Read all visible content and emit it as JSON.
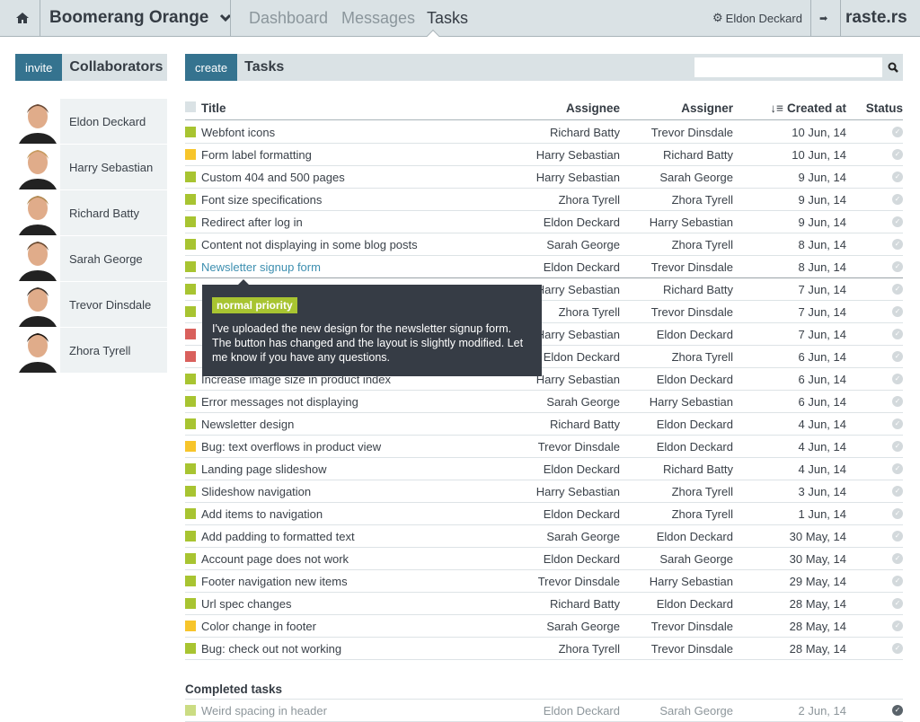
{
  "header": {
    "project": "Boomerang Orange",
    "nav": [
      "Dashboard",
      "Messages",
      "Tasks"
    ],
    "active_nav": "Tasks",
    "user": "Eldon Deckard",
    "brand": "raste.rs"
  },
  "collaborators": {
    "invite_label": "invite",
    "title": "Collaborators",
    "people": [
      "Eldon Deckard",
      "Harry Sebastian",
      "Richard Batty",
      "Sarah George",
      "Trevor Dinsdale",
      "Zhora Tyrell"
    ]
  },
  "tasks": {
    "create_label": "create",
    "title": "Tasks",
    "search_placeholder": "",
    "columns": {
      "title": "Title",
      "assignee": "Assignee",
      "assigner": "Assigner",
      "created": "Created at",
      "status": "Status"
    },
    "colors": {
      "normal": "#a8c431",
      "medium": "#f7c52b",
      "high": "#d9605c"
    },
    "rows": [
      {
        "title": "Webfont icons",
        "assignee": "Richard Batty",
        "assigner": "Trevor Dinsdale",
        "created": "10 Jun, 14",
        "priority": "normal"
      },
      {
        "title": "Form label formatting",
        "assignee": "Harry Sebastian",
        "assigner": "Richard Batty",
        "created": "10 Jun, 14",
        "priority": "medium"
      },
      {
        "title": "Custom 404 and 500 pages",
        "assignee": "Harry Sebastian",
        "assigner": "Sarah George",
        "created": "9 Jun, 14",
        "priority": "normal"
      },
      {
        "title": "Font size specifications",
        "assignee": "Zhora Tyrell",
        "assigner": "Zhora Tyrell",
        "created": "9 Jun, 14",
        "priority": "normal"
      },
      {
        "title": "Redirect after log in",
        "assignee": "Eldon Deckard",
        "assigner": "Harry Sebastian",
        "created": "9 Jun, 14",
        "priority": "normal"
      },
      {
        "title": "Content not displaying in some blog posts",
        "assignee": "Sarah George",
        "assigner": "Zhora Tyrell",
        "created": "8 Jun, 14",
        "priority": "normal"
      },
      {
        "title": "Newsletter signup form",
        "assignee": "Eldon Deckard",
        "assigner": "Trevor Dinsdale",
        "created": "8 Jun, 14",
        "priority": "normal",
        "hover": true
      },
      {
        "title": "",
        "assignee": "Harry Sebastian",
        "assigner": "Richard Batty",
        "created": "7 Jun, 14",
        "priority": "normal"
      },
      {
        "title": "",
        "assignee": "Zhora Tyrell",
        "assigner": "Trevor Dinsdale",
        "created": "7 Jun, 14",
        "priority": "normal"
      },
      {
        "title": "",
        "assignee": "Harry Sebastian",
        "assigner": "Eldon Deckard",
        "created": "7 Jun, 14",
        "priority": "high"
      },
      {
        "title": "",
        "assignee": "Eldon Deckard",
        "assigner": "Zhora Tyrell",
        "created": "6 Jun, 14",
        "priority": "high"
      },
      {
        "title": "Increase image size in product index",
        "assignee": "Harry Sebastian",
        "assigner": "Eldon Deckard",
        "created": "6 Jun, 14",
        "priority": "normal"
      },
      {
        "title": "Error messages not displaying",
        "assignee": "Sarah George",
        "assigner": "Harry Sebastian",
        "created": "6 Jun, 14",
        "priority": "normal"
      },
      {
        "title": "Newsletter design",
        "assignee": "Richard Batty",
        "assigner": "Eldon Deckard",
        "created": "4 Jun, 14",
        "priority": "normal"
      },
      {
        "title": "Bug: text overflows in product view",
        "assignee": "Trevor Dinsdale",
        "assigner": "Eldon Deckard",
        "created": "4 Jun, 14",
        "priority": "medium"
      },
      {
        "title": "Landing page slideshow",
        "assignee": "Eldon Deckard",
        "assigner": "Richard Batty",
        "created": "4 Jun, 14",
        "priority": "normal"
      },
      {
        "title": "Slideshow navigation",
        "assignee": "Harry Sebastian",
        "assigner": "Zhora Tyrell",
        "created": "3 Jun, 14",
        "priority": "normal"
      },
      {
        "title": "Add items to navigation",
        "assignee": "Eldon Deckard",
        "assigner": "Zhora Tyrell",
        "created": "1 Jun, 14",
        "priority": "normal"
      },
      {
        "title": "Add padding to formatted text",
        "assignee": "Sarah George",
        "assigner": "Eldon Deckard",
        "created": "30 May, 14",
        "priority": "normal"
      },
      {
        "title": "Account page does not work",
        "assignee": "Eldon Deckard",
        "assigner": "Sarah George",
        "created": "30 May, 14",
        "priority": "normal"
      },
      {
        "title": "Footer navigation new items",
        "assignee": "Trevor Dinsdale",
        "assigner": "Harry Sebastian",
        "created": "29 May, 14",
        "priority": "normal"
      },
      {
        "title": "Url spec changes",
        "assignee": "Richard Batty",
        "assigner": "Eldon Deckard",
        "created": "28 May, 14",
        "priority": "normal"
      },
      {
        "title": "Color change in footer",
        "assignee": "Sarah George",
        "assigner": "Trevor Dinsdale",
        "created": "28 May, 14",
        "priority": "medium"
      },
      {
        "title": "Bug: check out not working",
        "assignee": "Zhora Tyrell",
        "assigner": "Trevor Dinsdale",
        "created": "28 May, 14",
        "priority": "normal"
      }
    ],
    "tooltip": {
      "badge": "normal priority",
      "text": "I've uploaded the new design for the newsletter signup form. The button has changed and the layout is slightly modified. Let me know if you have any questions."
    },
    "completed_title": "Completed tasks",
    "completed": [
      {
        "title": "Weird spacing in header",
        "assignee": "Eldon Deckard",
        "assigner": "Sarah George",
        "created": "2 Jun, 14",
        "priority": "normal"
      }
    ]
  }
}
